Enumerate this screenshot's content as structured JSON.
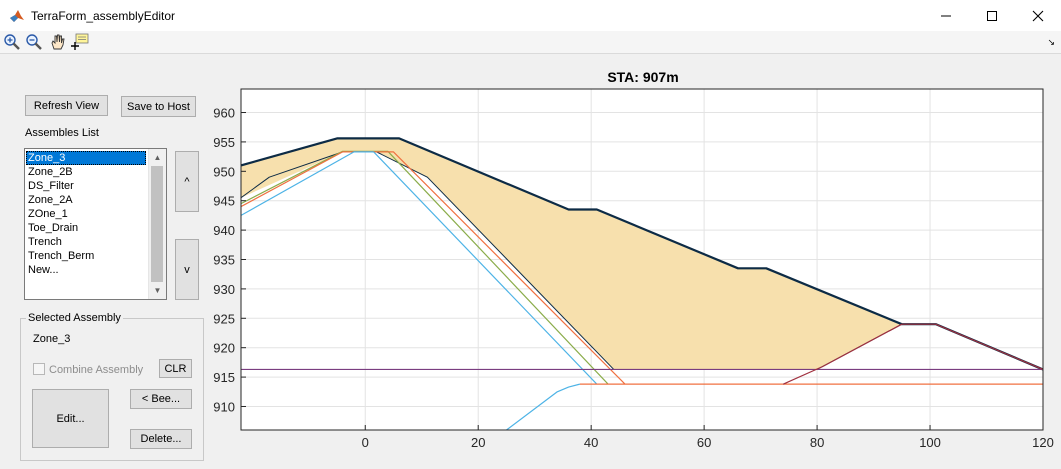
{
  "window": {
    "title": "TerraForm_assemblyEditor"
  },
  "toolbar": {
    "icons": [
      "zoom-in-icon",
      "zoom-out-icon",
      "pan-hand-icon",
      "data-cursor-icon"
    ],
    "corner_glyph": "↘"
  },
  "buttons": {
    "refresh": "Refresh View",
    "save": "Save to Host",
    "up": "^",
    "down": "v",
    "clr": "CLR",
    "edit": "Edit...",
    "bee": "< Bee...",
    "delete": "Delete..."
  },
  "assemblies": {
    "label": "Assembles List",
    "items": [
      "Zone_3",
      "Zone_2B",
      "DS_Filter",
      "Zone_2A",
      "ZOne_1",
      "Toe_Drain",
      "Trench",
      "Trench_Berm",
      "New..."
    ],
    "selected_index": 0
  },
  "selected_assembly": {
    "title": "Selected Assembly",
    "name": "Zone_3",
    "combine_label": "Combine Assembly",
    "combine_checked": false
  },
  "chart_data": {
    "type": "line",
    "title": "STA: 907m",
    "xlabel": "",
    "ylabel": "",
    "xlim": [
      -22,
      120
    ],
    "ylim": [
      906,
      964
    ],
    "xticks": [
      0,
      20,
      40,
      60,
      80,
      100,
      120
    ],
    "yticks": [
      910,
      915,
      920,
      925,
      930,
      935,
      940,
      945,
      950,
      955,
      960
    ],
    "grid": true,
    "legend": "none",
    "colors": {
      "ground": "#0d2b45",
      "fill": "#f7e0ad",
      "blue": "#4db3e6",
      "green": "#8aac4a",
      "orange": "#f07040",
      "purple": "#7a3d80",
      "crimson": "#a0303f",
      "grid": "#e3e3e3"
    },
    "filled_zone": {
      "x": [
        -22,
        -5,
        6,
        36,
        41,
        66,
        71,
        95,
        80,
        44,
        11,
        2,
        -4,
        -22
      ],
      "y": [
        951,
        955.6,
        955.6,
        943.5,
        943.5,
        933.5,
        933.5,
        924,
        916.3,
        916.3,
        949,
        953.3,
        953.3,
        945.5
      ]
    },
    "series": [
      {
        "color": "ground",
        "width": 2.2,
        "x": [
          -22,
          -5,
          6,
          36,
          41,
          66,
          71,
          95,
          101,
          120
        ],
        "y": [
          951,
          955.6,
          955.6,
          943.5,
          943.5,
          933.5,
          933.5,
          924,
          924,
          916.3
        ]
      },
      {
        "color": "ground",
        "width": 1,
        "x": [
          -22,
          -17,
          -4,
          2,
          11,
          44,
          80
        ],
        "y": [
          945.5,
          949,
          953.3,
          953.3,
          949,
          916.3,
          916.3
        ]
      },
      {
        "color": "ground",
        "width": 1,
        "x": [
          80,
          95
        ],
        "y": [
          916.3,
          924
        ]
      },
      {
        "color": "green",
        "width": 1.2,
        "x": [
          -22,
          -4,
          4,
          43
        ],
        "y": [
          944.5,
          953.4,
          953.4,
          913.8
        ]
      },
      {
        "color": "orange",
        "width": 1.2,
        "x": [
          -22,
          -4,
          5,
          46
        ],
        "y": [
          944,
          953.3,
          953.3,
          913.8
        ]
      },
      {
        "color": "blue",
        "width": 1.2,
        "x": [
          -22,
          -2,
          1.5
        ],
        "y": [
          942.5,
          953.3,
          953.3
        ]
      },
      {
        "color": "blue",
        "width": 1.2,
        "x": [
          1.5,
          41
        ],
        "y": [
          953.3,
          913.8
        ]
      },
      {
        "color": "orange",
        "width": 1.2,
        "x": [
          38,
          120
        ],
        "y": [
          913.8,
          913.8
        ]
      },
      {
        "color": "purple",
        "width": 1.2,
        "x": [
          -22,
          120
        ],
        "y": [
          916.3,
          916.3
        ]
      },
      {
        "color": "crimson",
        "width": 1.2,
        "x": [
          74,
          81,
          95,
          101,
          120
        ],
        "y": [
          913.8,
          916.8,
          924,
          924,
          916.3
        ]
      },
      {
        "color": "blue",
        "width": 1.2,
        "x": [
          25,
          34,
          36,
          38
        ],
        "y": [
          906,
          912.5,
          913.3,
          913.8
        ]
      }
    ]
  }
}
